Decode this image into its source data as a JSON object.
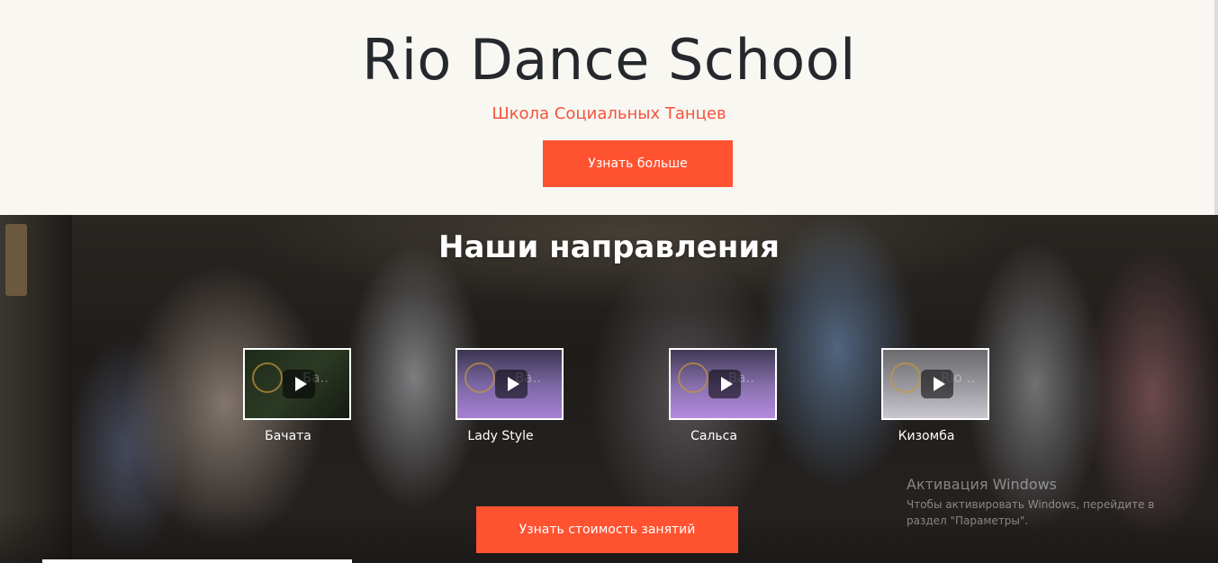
{
  "hero": {
    "title": "Rio Dance School",
    "subtitle": "Школа Социальных Танцев",
    "cta_label": "Узнать больше"
  },
  "directions": {
    "heading": "Наши направления",
    "videos": [
      {
        "thumb_text": "Ба..",
        "caption": "Бачата"
      },
      {
        "thumb_text": "Ва..",
        "caption": "Lady Style"
      },
      {
        "thumb_text": "Ва..",
        "caption": "Сальса"
      },
      {
        "thumb_text": "Rio ..",
        "caption": "Кизомба"
      }
    ],
    "cta_label": "Узнать стоимость занятий"
  },
  "os_overlay": {
    "title": "Активация Windows",
    "text": "Чтобы активировать Windows, перейдите в раздел \"Параметры\"."
  },
  "colors": {
    "accent": "#ff5231",
    "subtitle": "#f4533b",
    "background": "#f8f7f2",
    "title": "#25282c"
  }
}
